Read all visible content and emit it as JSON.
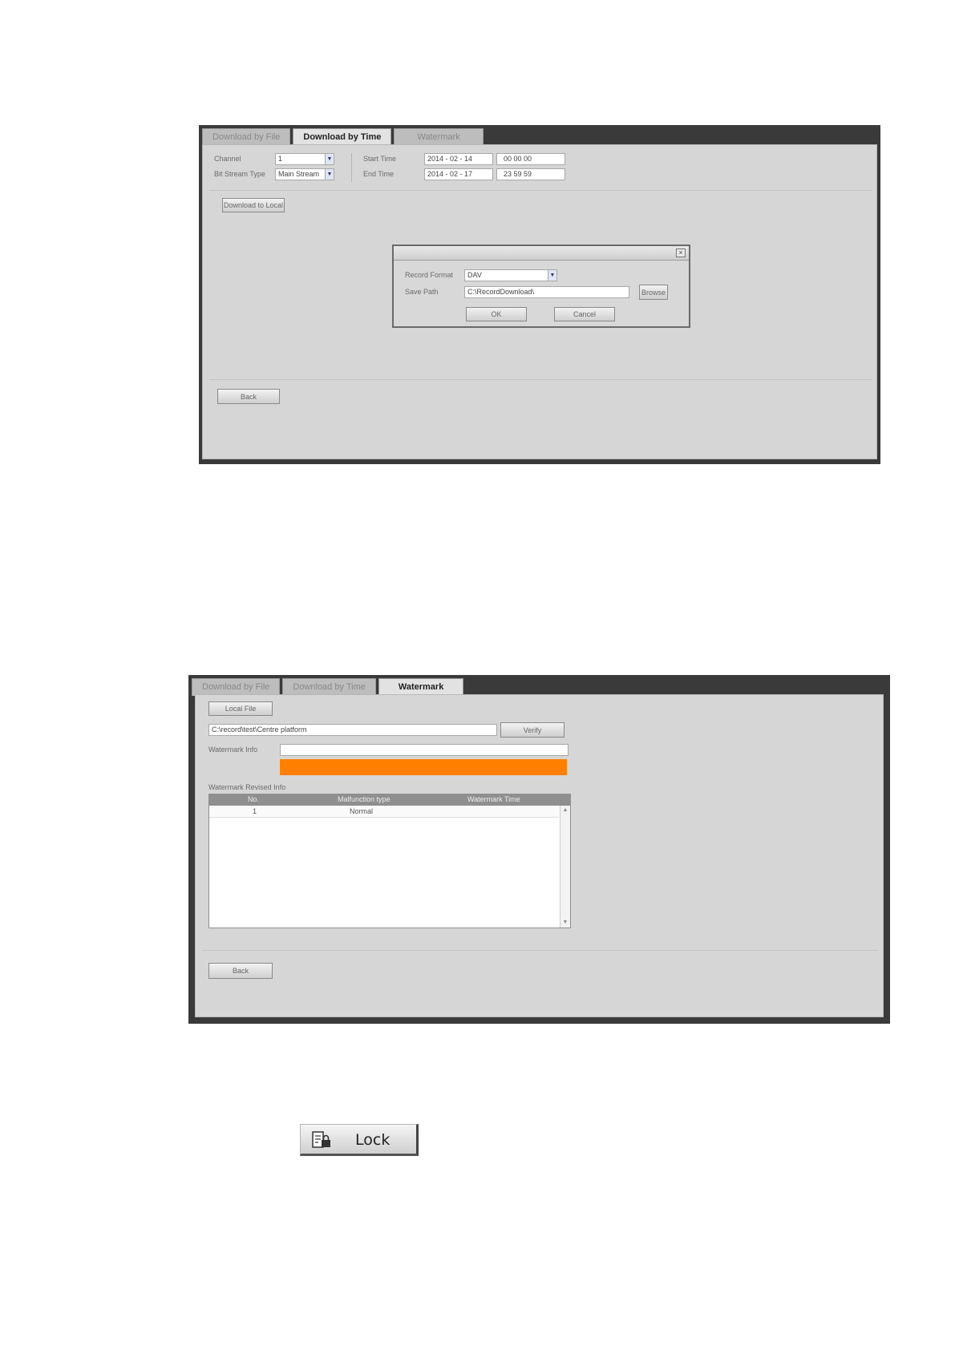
{
  "panel1": {
    "tabs": [
      {
        "label": "Download by File",
        "active": false
      },
      {
        "label": "Download by Time",
        "active": true
      },
      {
        "label": "Watermark",
        "active": false
      }
    ],
    "channel_label": "Channel",
    "channel_value": "1",
    "stream_label": "Bit Stream Type",
    "stream_value": "Main Stream",
    "start_label": "Start Time",
    "start_date": "2014 -  02  -  14",
    "start_time": "00   00   00",
    "end_label": "End Time",
    "end_date": "2014 -  02  -  17",
    "end_time": "23   59   59",
    "download_local_label": "Download to Local",
    "back_label": "Back",
    "dialog": {
      "record_format_label": "Record Format",
      "record_format_value": "DAV",
      "save_path_label": "Save Path",
      "save_path_value": "C:\\RecordDownload\\",
      "browse_label": "Browse",
      "ok_label": "OK",
      "cancel_label": "Cancel"
    }
  },
  "panel2": {
    "tabs": [
      {
        "label": "Download by File",
        "active": false
      },
      {
        "label": "Download by Time",
        "active": false
      },
      {
        "label": "Watermark",
        "active": true
      }
    ],
    "local_file_label": "Local File",
    "file_path_value": "C:\\record\\test\\Centre platform",
    "verify_label": "Verify",
    "watermark_info_label": "Watermark Info",
    "watermark_info_value": "",
    "progress_color": "#ff8000",
    "progress_fraction": 1.0,
    "revised_info_label": "Watermark Revised Info",
    "table": {
      "columns": [
        "No.",
        "Malfunction type",
        "Watermark Time"
      ],
      "rows": [
        {
          "no": "1",
          "type": "Normal",
          "time": ""
        }
      ]
    },
    "back_label": "Back"
  },
  "lock_button": {
    "label": "Lock",
    "icon": "lock-file-icon"
  }
}
